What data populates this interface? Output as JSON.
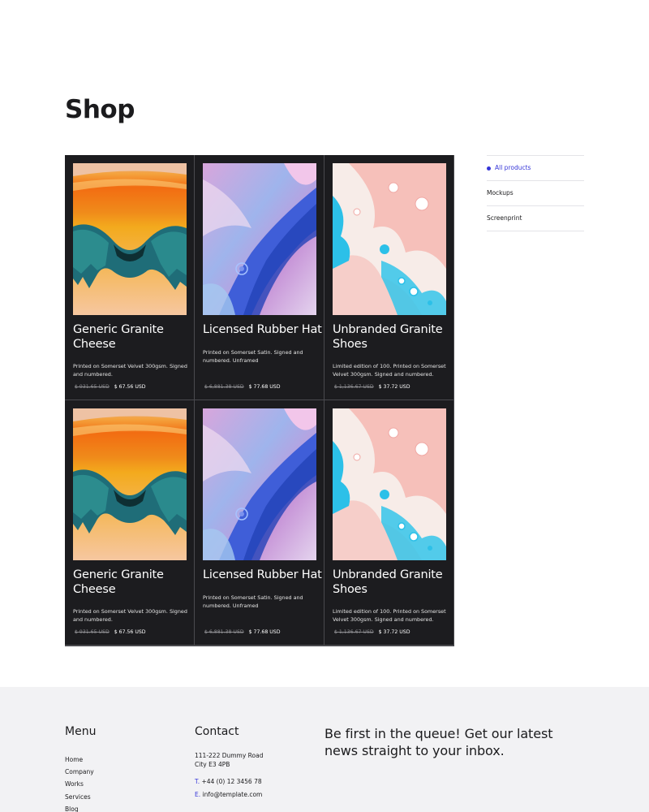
{
  "page": {
    "title": "Shop"
  },
  "products": [
    {
      "name": "Generic Granite Cheese",
      "description": "Printed on Somerset Velvet 300gsm. Signed and numbered.",
      "old_price": "$ 931.65 USD",
      "price": "$ 67.56 USD",
      "image": "orange-teal-drip-abstract-art"
    },
    {
      "name": "Licensed Rubber Hat",
      "description": "Printed on Somerset Satin. Signed and numbered. Unframed",
      "old_price": "$ 6,881.38 USD",
      "price": "$ 77.68 USD",
      "image": "blue-pink-fluid-abstract-art"
    },
    {
      "name": "Unbranded Granite Shoes",
      "description": "Limited edition of 100. Printed on Somerset Velvet 300gsm. Signed and numbered.",
      "old_price": "$ 1,136.67 USD",
      "price": "$ 37.72 USD",
      "image": "pink-cyan-cell-abstract-art"
    },
    {
      "name": "Generic Granite Cheese",
      "description": "Printed on Somerset Velvet 300gsm. Signed and numbered.",
      "old_price": "$ 931.65 USD",
      "price": "$ 67.56 USD",
      "image": "orange-teal-drip-abstract-art"
    },
    {
      "name": "Licensed Rubber Hat",
      "description": "Printed on Somerset Satin. Signed and numbered. Unframed",
      "old_price": "$ 6,881.38 USD",
      "price": "$ 77.68 USD",
      "image": "blue-pink-fluid-abstract-art"
    },
    {
      "name": "Unbranded Granite Shoes",
      "description": "Limited edition of 100. Printed on Somerset Velvet 300gsm. Signed and numbered.",
      "old_price": "$ 1,136.67 USD",
      "price": "$ 37.72 USD",
      "image": "pink-cyan-cell-abstract-art"
    }
  ],
  "categories": {
    "items": [
      {
        "label": "All products",
        "active": true
      },
      {
        "label": "Mockups",
        "active": false
      },
      {
        "label": "Screenprint",
        "active": false
      }
    ]
  },
  "footer": {
    "menu": {
      "heading": "Menu",
      "items": [
        "Home",
        "Company",
        "Works",
        "Services",
        "Blog"
      ]
    },
    "contact": {
      "heading": "Contact",
      "address_line1": "111-222 Dummy Road",
      "address_line2": "City E3 4PB",
      "phone_prefix": "T.",
      "phone": "+44 (0) 12 3456 78",
      "email_prefix": "E.",
      "email": "info@template.com"
    },
    "newsletter": {
      "text": "Be first in the queue! Get our latest news straight to your inbox."
    }
  },
  "colors": {
    "accent": "#3535d8",
    "card_background": "#1c1c1f",
    "footer_background": "#f2f2f4",
    "text": "#1b1b1d"
  }
}
